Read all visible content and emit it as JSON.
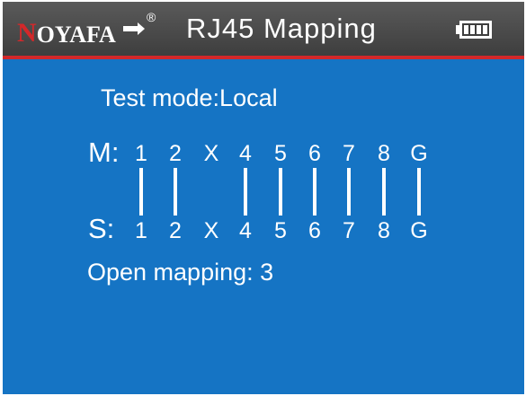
{
  "header": {
    "brand_first": "N",
    "brand_rest": "OYAFA",
    "registered_mark": "®",
    "title": "RJ45  Mapping",
    "battery_icon": "battery-full-icon"
  },
  "test_mode": "Test mode:Local",
  "map": {
    "master_label": "M:",
    "slave_label": "S:",
    "master_pins": [
      "1",
      "2",
      "X",
      "4",
      "5",
      "6",
      "7",
      "8",
      "G"
    ],
    "slave_pins": [
      "1",
      "2",
      "X",
      "4",
      "5",
      "6",
      "7",
      "8",
      "G"
    ],
    "connected": [
      true,
      true,
      false,
      true,
      true,
      true,
      true,
      true,
      true
    ]
  },
  "open_mapping": "Open mapping: 3",
  "colors": {
    "screen_bg": "#1574c4",
    "header_bg": "#4a4a4a",
    "header_line": "#d3282a",
    "text": "#ffffff"
  }
}
